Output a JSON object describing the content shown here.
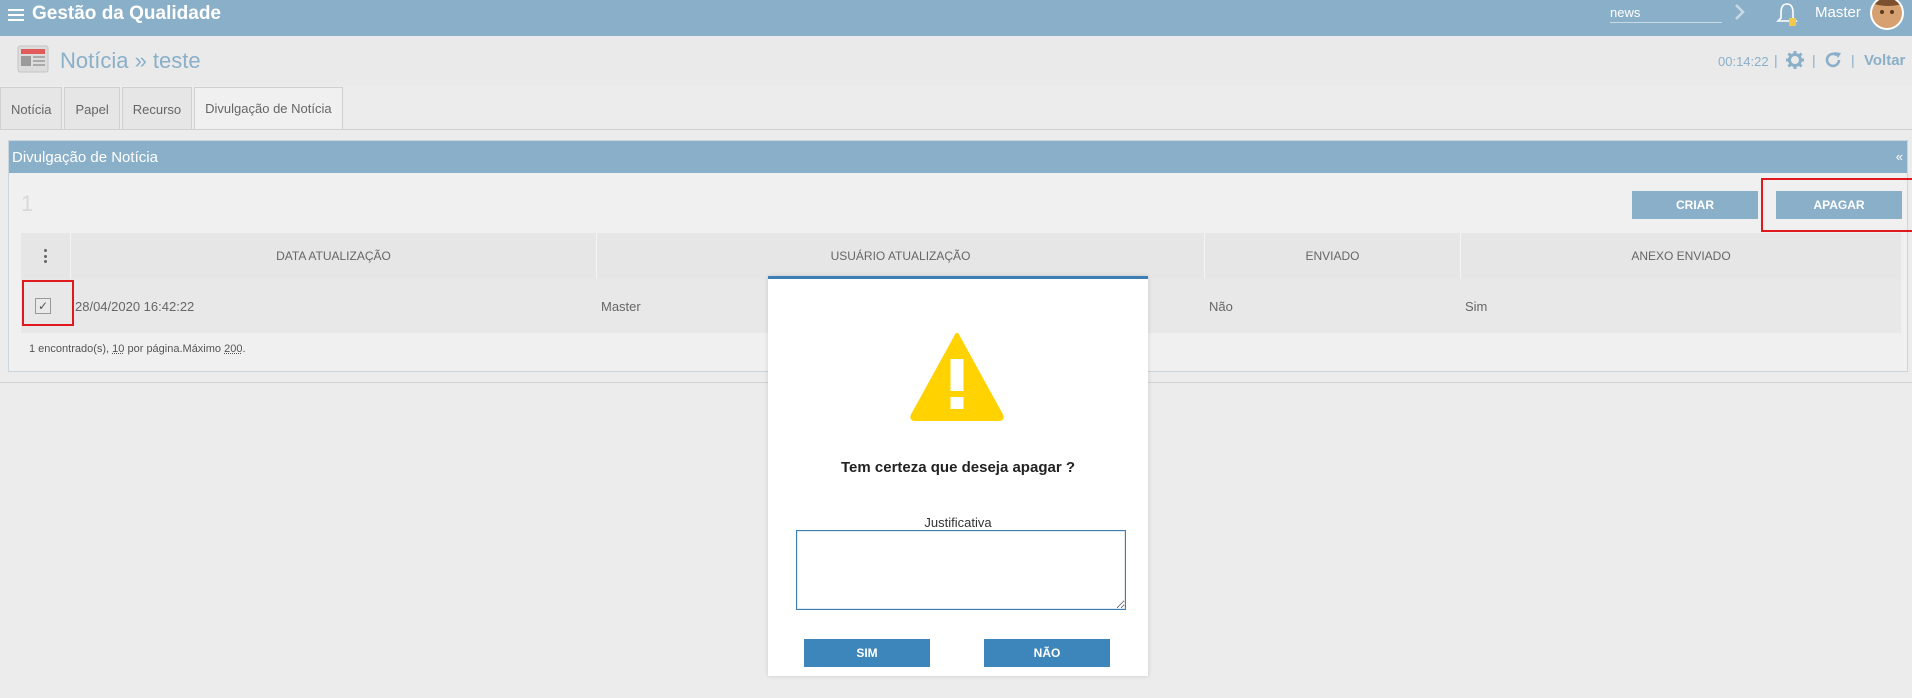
{
  "topbar": {
    "app_title": "Gestão da Qualidade",
    "search_value": "news",
    "user_name": "Master"
  },
  "header": {
    "title": "Notícia » teste",
    "clock": "00:14:22",
    "voltar_label": "Voltar"
  },
  "tabs": [
    {
      "label": "Notícia"
    },
    {
      "label": "Papel"
    },
    {
      "label": "Recurso"
    },
    {
      "label": "Divulgação de Notícia"
    }
  ],
  "panel": {
    "title": "Divulgação de Notícia",
    "collapse_glyph": "«",
    "count": "1",
    "criar_label": "CRIAR",
    "apagar_label": "APAGAR"
  },
  "table": {
    "menu_glyph": "⋮",
    "columns": [
      "DATA ATUALIZAÇÃO",
      "USUÁRIO ATUALIZAÇÃO",
      "ENVIADO",
      "ANEXO ENVIADO"
    ],
    "rows": [
      {
        "checked": "✓",
        "data": "28/04/2020 16:42:22",
        "usuario": "Master",
        "enviado": "Não",
        "anexo": "Sim"
      }
    ],
    "footer": {
      "found": "1 encontrado(s),",
      "per_page": "10",
      "per_page_suffix": "por página.Máximo",
      "max": "200",
      "end": "."
    }
  },
  "modal": {
    "question": "Tem certeza que deseja apagar ?",
    "label": "Justificativa",
    "textarea_value": "",
    "sim_label": "SIM",
    "nao_label": "NÃO"
  },
  "colors": {
    "topbar": "#8aafc8",
    "modal_button": "#3d86bc",
    "highlight": "#e0191e",
    "warning": "#ffd200"
  }
}
